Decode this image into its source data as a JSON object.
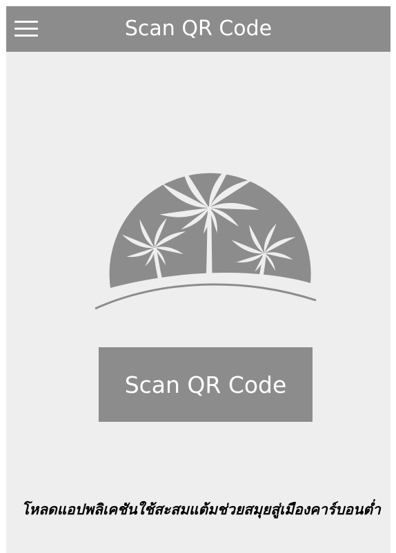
{
  "colors": {
    "app_bar": "#8c8c8c",
    "background": "#eeeeee",
    "logo": "#8c8c8c",
    "button": "#8c8c8c",
    "on_primary": "#ffffff"
  },
  "header": {
    "menu_icon": "hamburger-menu-icon",
    "title": "Scan QR Code"
  },
  "main": {
    "logo": "palm-tree-sunset-logo",
    "scan_button_label": "Scan QR Code"
  },
  "footer": {
    "text": "โหลดแอปพลิเคชันใช้สะสมแต้มช่วยสมุยสู่เมืองคาร์บอนต่ำ"
  }
}
